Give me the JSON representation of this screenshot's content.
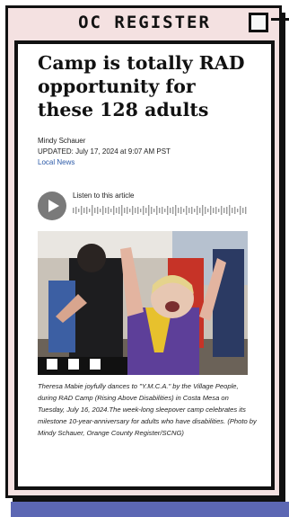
{
  "window": {
    "title": "OC REGISTER"
  },
  "article": {
    "headline": "Camp is totally RAD opportunity for these 128 adults",
    "author": "Mindy Schauer",
    "updated": "UPDATED: July 17, 2024 at 9:07 AM PST",
    "category": "Local News",
    "audio_label": "Listen to this article",
    "caption": "Theresa Mabie joyfully dances to \"Y.M.C.A.\" by the Village People, during RAD Camp (Rising Above Disabilities) in Costa Mesa on Tuesday, July 16, 2024.The week-long sleepover camp celebrates its milestone 10-year-anniversary for adults who have disabilities. (Photo by Mindy Schauer, Orange County Register/SCNG)"
  },
  "colors": {
    "frame_bg": "#f4e1e1",
    "accent_bar": "#5c67b3",
    "link": "#2c5aa8"
  }
}
